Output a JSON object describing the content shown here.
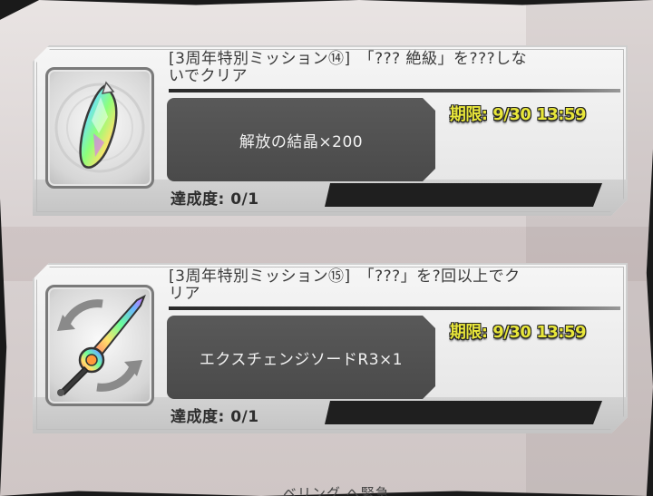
{
  "missions": [
    {
      "title_line1": "[3周年特別ミッション⑭]　「??? 絶級」を???しな",
      "title_line2": "いでクリア",
      "reward": "解放の結晶×200",
      "deadline": "期限: 9/30 13:59",
      "progress_label": "達成度: 0/1",
      "progress_fraction": 0,
      "icon": "rainbow-crystal-icon"
    },
    {
      "title_line1": "[3周年特別ミッション⑮]　「???」を?回以上でク",
      "title_line2": "リア",
      "reward": "エクスチェンジソードR3×1",
      "deadline": "期限: 9/30 13:59",
      "progress_label": "達成度: 0/1",
      "progress_fraction": 0,
      "icon": "exchange-sword-icon"
    }
  ],
  "footer_partial_text": "ベリング へ緊急",
  "colors": {
    "deadline": "#e8e63a",
    "reward_bg": "#595959",
    "progress_bg": "#1f1f1f"
  }
}
